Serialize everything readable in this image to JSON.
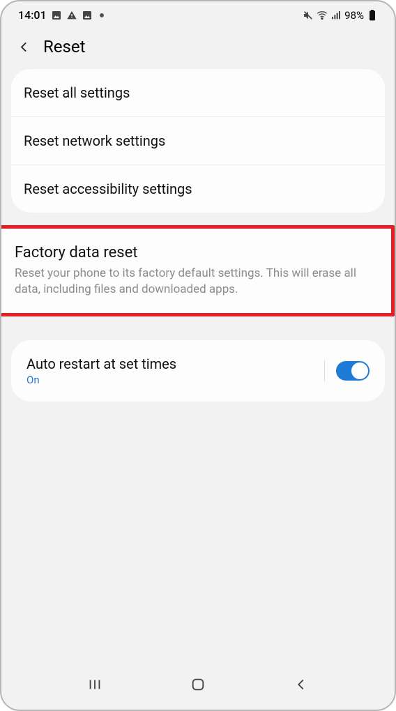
{
  "status": {
    "time": "14:01",
    "battery_pct": "98%"
  },
  "header": {
    "title": "Reset"
  },
  "resetOptions": {
    "items": [
      {
        "label": "Reset all settings"
      },
      {
        "label": "Reset network settings"
      },
      {
        "label": "Reset accessibility settings"
      }
    ]
  },
  "factoryReset": {
    "title": "Factory data reset",
    "description": "Reset your phone to its factory default settings. This will erase all data, including files and downloaded apps."
  },
  "autoRestart": {
    "title": "Auto restart at set times",
    "status": "On",
    "enabled": true
  }
}
